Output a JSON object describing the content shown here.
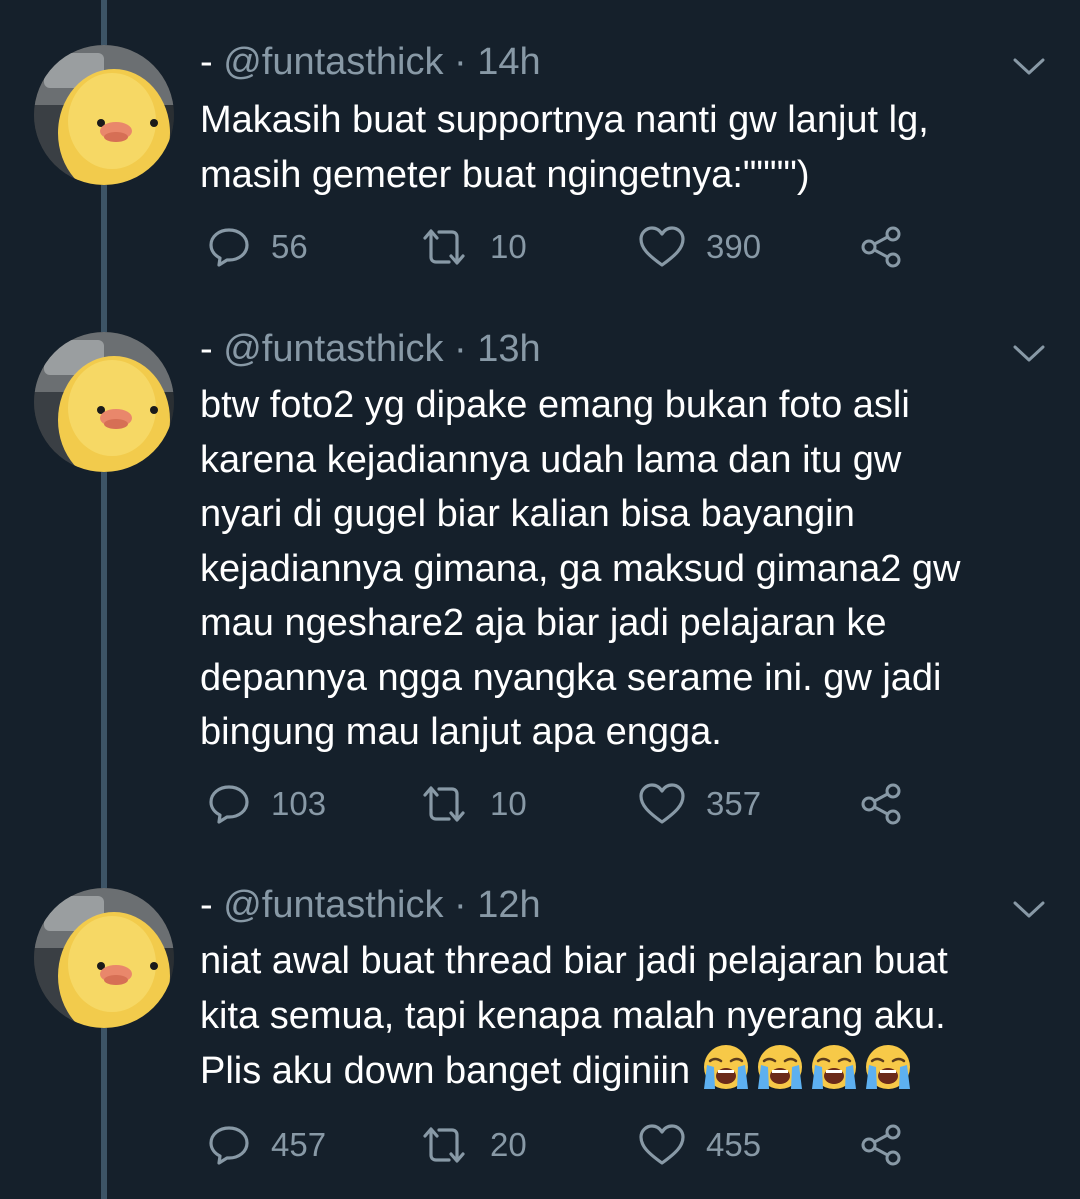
{
  "tweets": [
    {
      "name": "-",
      "handle": "@funtasthick",
      "sep": "·",
      "time": "14h",
      "lines": [
        "Makasih buat supportnya nanti gw lanjut lg,",
        "masih gemeter buat ngingetnya:\"\"\"\")"
      ],
      "reply_count": "56",
      "retweet_count": "10",
      "like_count": "390"
    },
    {
      "name": "-",
      "handle": "@funtasthick",
      "sep": "·",
      "time": "13h",
      "lines": [
        "btw foto2 yg dipake emang bukan foto asli",
        "karena kejadiannya udah lama dan itu gw",
        "nyari di gugel biar kalian bisa bayangin",
        "kejadiannya gimana, ga maksud gimana2 gw",
        "mau ngeshare2 aja biar jadi pelajaran ke",
        "depannya ngga nyangka serame ini. gw jadi",
        "bingung mau lanjut apa engga."
      ],
      "reply_count": "103",
      "retweet_count": "10",
      "like_count": "357"
    },
    {
      "name": "-",
      "handle": "@funtasthick",
      "sep": "·",
      "time": "12h",
      "lines": [
        "niat awal buat thread biar jadi pelajaran buat",
        "kita semua, tapi kenapa malah nyerang aku.",
        "Plis aku down banget diginiin"
      ],
      "emoji": "loudly-crying-face x4",
      "reply_count": "457",
      "retweet_count": "20",
      "like_count": "455"
    }
  ],
  "colors": {
    "background": "#15202b",
    "text": "#ffffff",
    "secondary": "#8899a6",
    "thread_line": "#3d5466"
  }
}
